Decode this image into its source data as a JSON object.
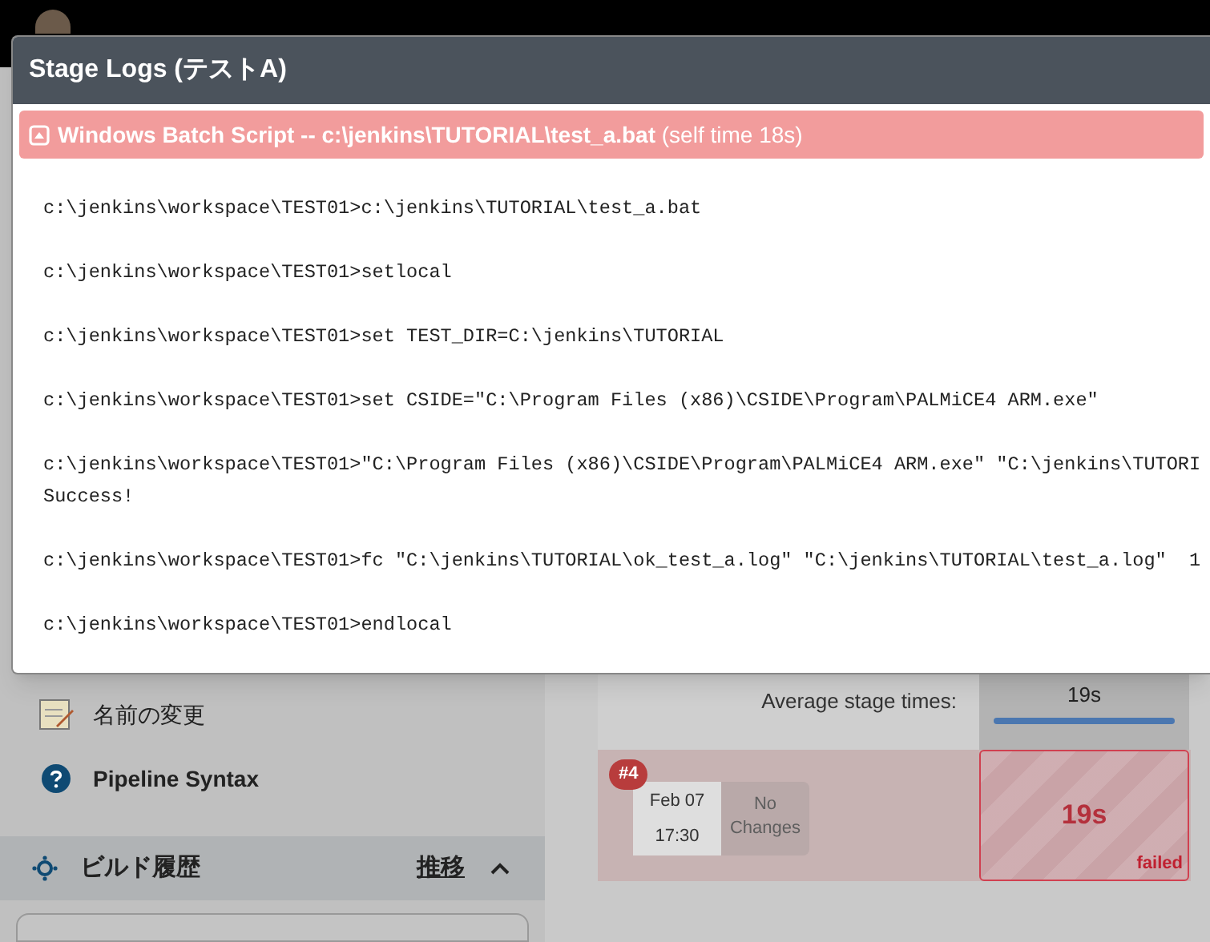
{
  "sidebar": {
    "items": [
      {
        "kind": "rename",
        "label": "名前の変更"
      },
      {
        "kind": "help",
        "label": "Pipeline Syntax"
      }
    ],
    "build_history": {
      "title": "ビルド履歴",
      "trend_link": "推移",
      "expanded": true
    }
  },
  "stage_view": {
    "average_label": "Average stage times:",
    "average_time": "19s",
    "builds": [
      {
        "number": "#4",
        "date": "Feb 07",
        "time": "17:30",
        "changes": "No Changes",
        "duration": "19s",
        "status": "failed"
      }
    ]
  },
  "dialog": {
    "title": "Stage Logs (テストA)",
    "step": {
      "title": "Windows Batch Script -- c:\\jenkins\\TUTORIAL\\test_a.bat",
      "self_time": "(self time 18s)"
    },
    "log": [
      [
        "c:\\jenkins\\workspace\\TEST01>c:\\jenkins\\TUTORIAL\\test_a.bat"
      ],
      [
        "c:\\jenkins\\workspace\\TEST01>setlocal"
      ],
      [
        "c:\\jenkins\\workspace\\TEST01>set TEST_DIR=C:\\jenkins\\TUTORIAL"
      ],
      [
        "c:\\jenkins\\workspace\\TEST01>set CSIDE=\"C:\\Program Files (x86)\\CSIDE\\Program\\PALMiCE4 ARM.exe\""
      ],
      [
        "c:\\jenkins\\workspace\\TEST01>\"C:\\Program Files (x86)\\CSIDE\\Program\\PALMiCE4 ARM.exe\" \"C:\\jenkins\\TUTORI",
        "Success!"
      ],
      [
        "c:\\jenkins\\workspace\\TEST01>fc \"C:\\jenkins\\TUTORIAL\\ok_test_a.log\" \"C:\\jenkins\\TUTORIAL\\test_a.log\"  1"
      ],
      [
        "c:\\jenkins\\workspace\\TEST01>endlocal"
      ]
    ]
  }
}
